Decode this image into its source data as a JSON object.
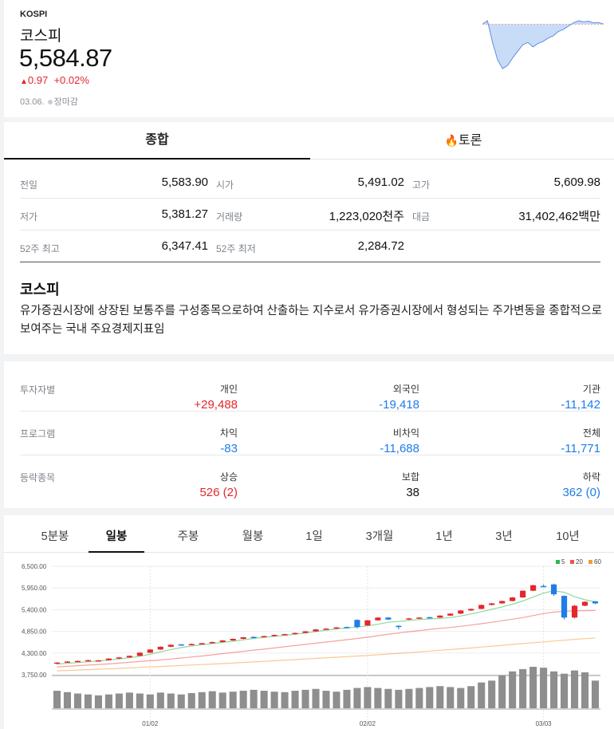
{
  "index": {
    "code": "KOSPI",
    "name": "코스피",
    "price": "5,584.87",
    "change_arrow": "▲",
    "change": "0.97",
    "change_pct": "+0.02%",
    "date": "03.06.",
    "market_status": "장마감"
  },
  "sparkline": [
    5584,
    5600,
    5500,
    5420,
    5380,
    5395,
    5430,
    5460,
    5490,
    5500,
    5480,
    5495,
    5505,
    5520,
    5530,
    5550,
    5560,
    5575,
    5590,
    5600,
    5595,
    5598,
    5590,
    5592,
    5585
  ],
  "tabs": {
    "summary": "종합",
    "discussion": "토론",
    "fire_icon": "fire-icon"
  },
  "stats": [
    [
      {
        "label": "전일",
        "value": "5,583.90",
        "tone": ""
      },
      {
        "label": "시가",
        "value": "5,491.02",
        "tone": "down"
      },
      {
        "label": "고가",
        "value": "5,609.98",
        "tone": "up"
      }
    ],
    [
      {
        "label": "저가",
        "value": "5,381.27",
        "tone": "down"
      },
      {
        "label": "거래량",
        "value": "1,223,020천주",
        "tone": ""
      },
      {
        "label": "대금",
        "value": "31,402,462백만",
        "tone": ""
      }
    ],
    [
      {
        "label": "52주 최고",
        "value": "6,347.41",
        "tone": ""
      },
      {
        "label": "52주 최저",
        "value": "2,284.72",
        "tone": ""
      }
    ]
  ],
  "description": {
    "title": "코스피",
    "text": "유가증권시장에 상장된 보통주를 구성종목으로하여 산출하는 지수로서 유가증권시장에서 형성되는 주가변동을 종합적으로 보여주는 국내 주요경제지표임"
  },
  "investors": [
    {
      "label": "투자자별",
      "cols": [
        {
          "head": "개인",
          "value": "+29,488",
          "tone": "up"
        },
        {
          "head": "외국인",
          "value": "-19,418",
          "tone": "down"
        },
        {
          "head": "기관",
          "value": "-11,142",
          "tone": "down"
        }
      ]
    },
    {
      "label": "프로그램",
      "cols": [
        {
          "head": "차익",
          "value": "-83",
          "tone": "down"
        },
        {
          "head": "비차익",
          "value": "-11,688",
          "tone": "down"
        },
        {
          "head": "전체",
          "value": "-11,771",
          "tone": "down"
        }
      ]
    },
    {
      "label": "등락종목",
      "cols": [
        {
          "head": "상승",
          "value": "526 (2)",
          "tone": "up"
        },
        {
          "head": "보합",
          "value": "38",
          "tone": ""
        },
        {
          "head": "하락",
          "value": "362 (0)",
          "tone": "down"
        }
      ]
    }
  ],
  "chart_tabs": [
    "5분봉",
    "일봉",
    "주봉",
    "월봉",
    "1일",
    "3개월",
    "1년",
    "3년",
    "10년"
  ],
  "chart_tab_active": 1,
  "colors": {
    "up": "#e5262b",
    "down": "#1f7ce8",
    "ma5": "#2db84b",
    "ma20": "#f0534f",
    "ma60": "#f59a3c"
  },
  "chart_data": {
    "type": "candlestick",
    "y_ticks": [
      "6,500.00",
      "5,950.00",
      "5,400.00",
      "4,850.00",
      "4,300.00",
      "3,750.00"
    ],
    "ylim": [
      3750,
      6500
    ],
    "x_ticks": [
      {
        "label": "01/02",
        "index": 9
      },
      {
        "label": "02/02",
        "index": 30
      },
      {
        "label": "03/03",
        "index": 47
      }
    ],
    "legend": [
      "5",
      "20",
      "60"
    ],
    "candles": [
      [
        4040,
        4060,
        4020,
        4070
      ],
      [
        4070,
        4085,
        4060,
        4095
      ],
      [
        4085,
        4100,
        4075,
        4110
      ],
      [
        4100,
        4120,
        4090,
        4130
      ],
      [
        4110,
        4115,
        4100,
        4125
      ],
      [
        4120,
        4160,
        4110,
        4170
      ],
      [
        4160,
        4190,
        4150,
        4200
      ],
      [
        4190,
        4230,
        4180,
        4240
      ],
      [
        4230,
        4310,
        4220,
        4320
      ],
      [
        4310,
        4390,
        4300,
        4400
      ],
      [
        4390,
        4460,
        4380,
        4470
      ],
      [
        4460,
        4510,
        4450,
        4520
      ],
      [
        4520,
        4500,
        4490,
        4530
      ],
      [
        4510,
        4530,
        4500,
        4545
      ],
      [
        4530,
        4550,
        4520,
        4560
      ],
      [
        4550,
        4580,
        4540,
        4590
      ],
      [
        4580,
        4620,
        4570,
        4630
      ],
      [
        4620,
        4660,
        4610,
        4670
      ],
      [
        4660,
        4700,
        4650,
        4710
      ],
      [
        4710,
        4690,
        4680,
        4720
      ],
      [
        4700,
        4730,
        4690,
        4740
      ],
      [
        4730,
        4760,
        4720,
        4770
      ],
      [
        4760,
        4780,
        4750,
        4790
      ],
      [
        4780,
        4810,
        4770,
        4820
      ],
      [
        4810,
        4850,
        4800,
        4860
      ],
      [
        4850,
        4900,
        4840,
        4910
      ],
      [
        4910,
        4920,
        4900,
        4930
      ],
      [
        4920,
        4950,
        4910,
        4960
      ],
      [
        4960,
        4940,
        4930,
        4970
      ],
      [
        5140,
        4960,
        4920,
        5160
      ],
      [
        5000,
        5130,
        4990,
        5140
      ],
      [
        5130,
        5200,
        5120,
        5210
      ],
      [
        5200,
        5150,
        5140,
        5210
      ],
      [
        4990,
        4960,
        4900,
        5010
      ],
      [
        5150,
        5180,
        5140,
        5190
      ],
      [
        5180,
        5200,
        5170,
        5210
      ],
      [
        5210,
        5190,
        5180,
        5220
      ],
      [
        5200,
        5250,
        5190,
        5260
      ],
      [
        5250,
        5300,
        5240,
        5310
      ],
      [
        5300,
        5380,
        5290,
        5390
      ],
      [
        5380,
        5420,
        5370,
        5430
      ],
      [
        5420,
        5520,
        5410,
        5530
      ],
      [
        5520,
        5560,
        5510,
        5570
      ],
      [
        5560,
        5620,
        5550,
        5630
      ],
      [
        5620,
        5710,
        5610,
        5720
      ],
      [
        5710,
        5880,
        5700,
        5890
      ],
      [
        5880,
        6020,
        5870,
        6030
      ],
      [
        6000,
        5990,
        5970,
        6040
      ],
      [
        6040,
        5790,
        5750,
        6060
      ],
      [
        5750,
        5200,
        5150,
        5760
      ],
      [
        5200,
        5500,
        5180,
        5520
      ],
      [
        5500,
        5600,
        5490,
        5610
      ],
      [
        5610,
        5560,
        5540,
        5620
      ]
    ],
    "ma5": [
      4020,
      4040,
      4060,
      4080,
      4100,
      4125,
      4150,
      4180,
      4220,
      4270,
      4330,
      4390,
      4440,
      4480,
      4510,
      4540,
      4570,
      4600,
      4635,
      4670,
      4700,
      4725,
      4750,
      4780,
      4810,
      4845,
      4880,
      4910,
      4940,
      4960,
      4990,
      5030,
      5080,
      5100,
      5130,
      5150,
      5165,
      5180,
      5200,
      5240,
      5290,
      5350,
      5410,
      5470,
      5540,
      5620,
      5720,
      5820,
      5880,
      5840,
      5730,
      5650,
      5600
    ],
    "ma20": [
      3950,
      3965,
      3980,
      3995,
      4010,
      4025,
      4045,
      4065,
      4085,
      4105,
      4125,
      4150,
      4175,
      4200,
      4225,
      4255,
      4285,
      4315,
      4345,
      4375,
      4400,
      4430,
      4460,
      4490,
      4520,
      4550,
      4580,
      4610,
      4640,
      4670,
      4700,
      4740,
      4780,
      4810,
      4840,
      4870,
      4900,
      4925,
      4950,
      4980,
      5010,
      5045,
      5080,
      5120,
      5160,
      5200,
      5250,
      5300,
      5340,
      5360,
      5370,
      5375,
      5380
    ],
    "ma60": [
      3850,
      3860,
      3870,
      3880,
      3890,
      3900,
      3912,
      3924,
      3936,
      3948,
      3960,
      3972,
      3984,
      3996,
      4008,
      4020,
      4034,
      4048,
      4062,
      4076,
      4090,
      4105,
      4120,
      4135,
      4150,
      4165,
      4180,
      4195,
      4210,
      4225,
      4240,
      4258,
      4276,
      4294,
      4312,
      4330,
      4350,
      4370,
      4390,
      4410,
      4430,
      4452,
      4474,
      4496,
      4518,
      4540,
      4562,
      4584,
      4606,
      4626,
      4646,
      4666,
      4685
    ],
    "volume": [
      38,
      35,
      32,
      30,
      28,
      30,
      32,
      34,
      32,
      30,
      34,
      32,
      30,
      33,
      35,
      37,
      34,
      36,
      38,
      40,
      38,
      36,
      35,
      38,
      40,
      42,
      38,
      36,
      40,
      44,
      46,
      44,
      42,
      40,
      42,
      44,
      46,
      48,
      46,
      44,
      48,
      56,
      60,
      72,
      80,
      85,
      90,
      88,
      80,
      75,
      82,
      78,
      60
    ]
  }
}
